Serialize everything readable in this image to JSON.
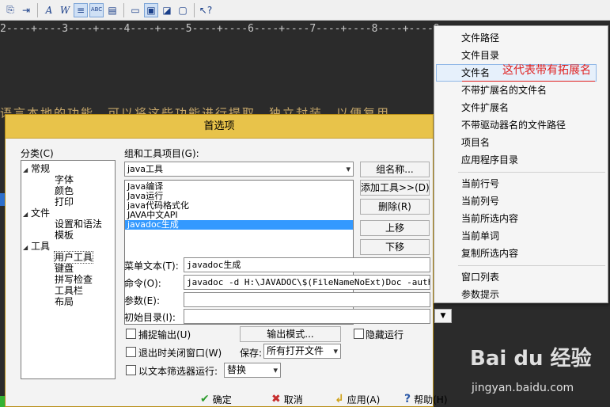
{
  "toolbar": {
    "icons": [
      "copy-icon",
      "indent-icon",
      "italic-font-icon",
      "word-wrap-icon",
      "wrap-toggle-icon",
      "spellcheck-icon",
      "settings-icon",
      "panel-icon",
      "panel-active-icon",
      "edit-panel-icon",
      "panel-plain-icon",
      "help-cursor-icon"
    ]
  },
  "ruler": {
    "text": "2----+----3----+----4----+----5----+----6----+----7----+----8----+----9----+"
  },
  "editor": {
    "visible_text": "语言本地的功能，可以将这些功能进行提取，独立封装，以便复用"
  },
  "dialog": {
    "title": "首选项",
    "category_label": "分类(C)",
    "tree": [
      {
        "label": "常规",
        "level": 0,
        "expanded": true
      },
      {
        "label": "字体",
        "level": 1
      },
      {
        "label": "颜色",
        "level": 1
      },
      {
        "label": "打印",
        "level": 1
      },
      {
        "label": "文件",
        "level": 0,
        "expanded": true
      },
      {
        "label": "设置和语法",
        "level": 1
      },
      {
        "label": "模板",
        "level": 1
      },
      {
        "label": "工具",
        "level": 0,
        "expanded": true
      },
      {
        "label": "用户工具",
        "level": 1,
        "selected": true
      },
      {
        "label": "键盘",
        "level": 1
      },
      {
        "label": "拼写检查",
        "level": 1
      },
      {
        "label": "工具栏",
        "level": 1
      },
      {
        "label": "布局",
        "level": 1
      }
    ],
    "group_label": "组和工具项目(G):",
    "group_value": "java工具",
    "tools": [
      "Java编译",
      "Java运行",
      "java代码格式化",
      "JAVA中文API",
      "javadoc生成"
    ],
    "selected_tool": "javadoc生成",
    "buttons": {
      "group_name": "组名称...",
      "add_tool": "添加工具>>(D)",
      "delete": "删除(R)",
      "move_up": "上移",
      "move_down": "下移"
    },
    "menu_text_label": "菜单文本(T):",
    "menu_text_value": "javadoc生成",
    "command_label": "命令(O):",
    "command_value": "javadoc -d H:\\JAVADOC\\$(FileNameNoExt)Doc -author -",
    "args_label": "参数(E):",
    "args_value": "",
    "initdir_label": "初始目录(I):",
    "initdir_value": "",
    "capture_output": "捕捉输出(U)",
    "output_mode": "输出模式...",
    "hide_run": "隐藏运行",
    "close_on_exit": "退出时关闭窗口(W)",
    "save_label": "保存:",
    "save_value": "所有打开文件",
    "text_filter": "以文本筛选器运行:",
    "replace_value": "替换",
    "ok": "确定",
    "cancel": "取消",
    "apply": "应用(A)",
    "help": "帮助(H)"
  },
  "context_menu": {
    "group1": [
      "文件路径",
      "文件目录",
      "文件名",
      "不带扩展名的文件名",
      "文件扩展名",
      "不带驱动器名的文件路径",
      "项目名",
      "应用程序目录"
    ],
    "group2": [
      "当前行号",
      "当前列号",
      "当前所选内容",
      "当前单词",
      "复制所选内容"
    ],
    "group3": [
      "窗口列表",
      "参数提示"
    ],
    "highlighted": "文件名"
  },
  "annotation": "这代表带有拓展名",
  "watermark": {
    "main": "Bai du 经验",
    "sub": "jingyan.baidu.com"
  }
}
